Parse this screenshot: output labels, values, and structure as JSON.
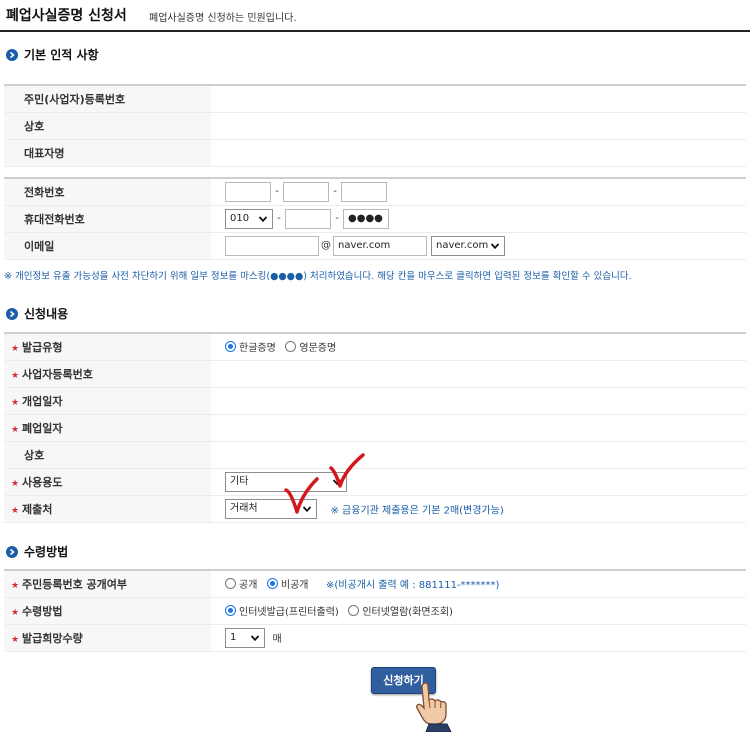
{
  "header": {
    "title": "폐업사실증명 신청서",
    "description": "폐업사실증명 신청하는 민원입니다."
  },
  "sections": {
    "basic": "기본 인적 사항",
    "request": "신청내용",
    "receipt": "수령방법"
  },
  "basic": {
    "labels": {
      "reg_no": "주민(사업자)등록번호",
      "company": "상호",
      "ceo": "대표자명"
    },
    "values": {
      "reg_no": "",
      "company": "",
      "ceo": ""
    }
  },
  "contact": {
    "labels": {
      "phone": "전화번호",
      "mobile": "휴대전화번호",
      "email": "이메일"
    },
    "phone": [
      "",
      "",
      ""
    ],
    "mobile": {
      "prefix": "010",
      "middle": "",
      "last": "●●●●"
    },
    "email": {
      "local": "",
      "domain": "naver.com",
      "domain_select": "naver.com"
    },
    "dash": "-",
    "at": "@"
  },
  "privacy_note": "※ 개인정보 유출 가능성을 사전 차단하기 위해 일부 정보를 마스킹(●●●●) 처리하였습니다. 해당 칸을 마우스로 클릭하면 입력된 정보를 확인할 수 있습니다.",
  "request": {
    "labels": {
      "issue_type": "발급유형",
      "biz_no": "사업자등록번호",
      "open_date": "개업일자",
      "close_date": "폐업일자",
      "company": "상호",
      "purpose": "사용용도",
      "submit_to": "제출처"
    },
    "issue_options": [
      "한글증명",
      "영문증명"
    ],
    "purpose": "기타",
    "submit_to": "거래처",
    "submit_note": "※ 금융기관 제출용은 기본 2매(변경가능)"
  },
  "receipt": {
    "labels": {
      "disclose": "주민등록번호 공개여부",
      "method": "수령방법",
      "copies": "발급희망수량"
    },
    "disclose_options": [
      "공개",
      "비공개"
    ],
    "disclose_note": "※(비공개시 출력 예 : 881111-*******)",
    "method_options": [
      "인터넷발급(프린터출력)",
      "인터넷열람(화면조회)"
    ],
    "copies": "1",
    "copies_unit": "매"
  },
  "submit_label": "신청하기",
  "colors": {
    "accent": "#1a5ea8",
    "required": "#d3303c",
    "check_mark": "#d6171e",
    "button": "#2f5f9e"
  }
}
